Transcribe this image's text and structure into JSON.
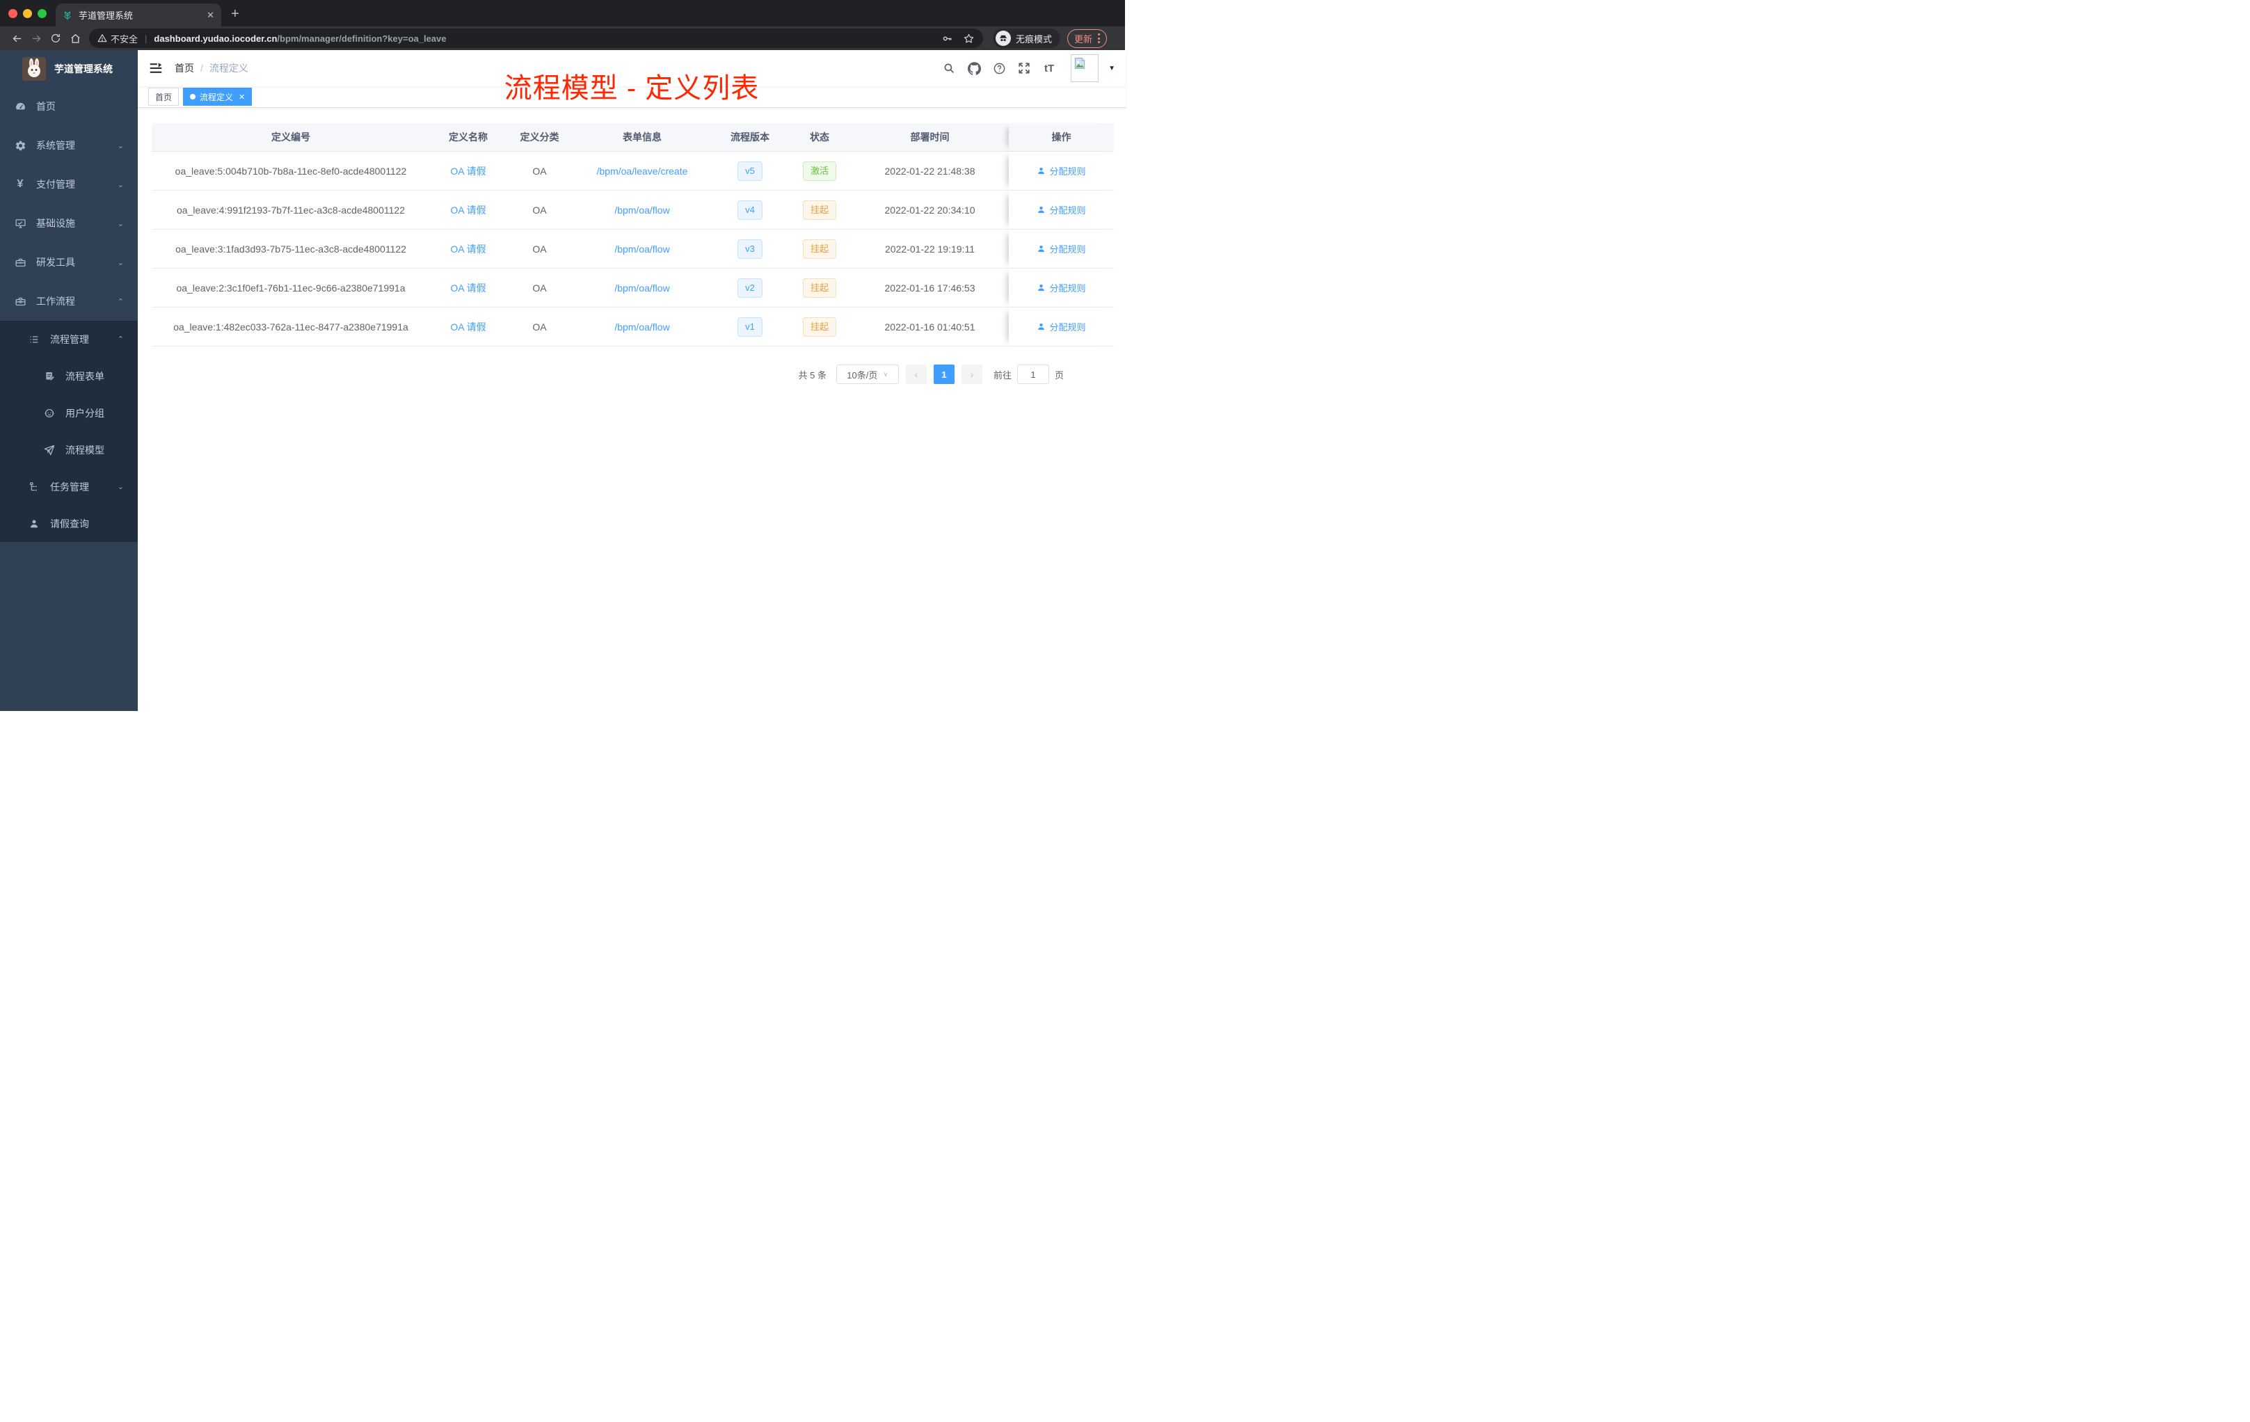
{
  "colors": {
    "accent": "#409EFF",
    "status_active": "#67C23A",
    "status_suspended": "#E6A23C",
    "overlay_red": "#FF2600",
    "sidebar_bg": "#304156",
    "submenu_bg": "#1F2D3D"
  },
  "browser": {
    "tab_title": "芋道管理系统",
    "close_glyph": "✕",
    "newtab_glyph": "+",
    "not_secure_label": "不安全",
    "url_host": "dashboard.yudao.iocoder.cn",
    "url_path": "/bpm/manager/definition?key=oa_leave",
    "incognito_label": "无痕模式",
    "update_label": "更新"
  },
  "sidebar": {
    "title": "芋道管理系统",
    "items": [
      {
        "label": "首页"
      },
      {
        "label": "系统管理"
      },
      {
        "label": "支付管理"
      },
      {
        "label": "基础设施"
      },
      {
        "label": "研发工具"
      },
      {
        "label": "工作流程"
      }
    ],
    "submenu": {
      "groups": [
        {
          "label": "流程管理",
          "children": [
            {
              "label": "流程表单"
            },
            {
              "label": "用户分组"
            },
            {
              "label": "流程模型"
            }
          ]
        },
        {
          "label": "任务管理"
        },
        {
          "label": "请假查询"
        }
      ]
    }
  },
  "navbar": {
    "breadcrumb": {
      "home": "首页",
      "separator": "/",
      "current": "流程定义"
    },
    "overlay_title": "流程模型 - 定义列表",
    "font_icon_label": "tT"
  },
  "tags": [
    {
      "label": "首页",
      "active": false
    },
    {
      "label": "流程定义",
      "active": true,
      "close_glyph": "✕"
    }
  ],
  "table": {
    "columns": [
      "定义编号",
      "定义名称",
      "定义分类",
      "表单信息",
      "流程版本",
      "状态",
      "部署时间",
      "操作"
    ],
    "rows": [
      {
        "id": "oa_leave:5:004b710b-7b8a-11ec-8ef0-acde48001122",
        "name": "OA 请假",
        "category": "OA",
        "form": "/bpm/oa/leave/create",
        "version": "v5",
        "status": "激活",
        "deployed": "2022-01-22 21:48:38",
        "action": "分配规则"
      },
      {
        "id": "oa_leave:4:991f2193-7b7f-11ec-a3c8-acde48001122",
        "name": "OA 请假",
        "category": "OA",
        "form": "/bpm/oa/flow",
        "version": "v4",
        "status": "挂起",
        "deployed": "2022-01-22 20:34:10",
        "action": "分配规则"
      },
      {
        "id": "oa_leave:3:1fad3d93-7b75-11ec-a3c8-acde48001122",
        "name": "OA 请假",
        "category": "OA",
        "form": "/bpm/oa/flow",
        "version": "v3",
        "status": "挂起",
        "deployed": "2022-01-22 19:19:11",
        "action": "分配规则"
      },
      {
        "id": "oa_leave:2:3c1f0ef1-76b1-11ec-9c66-a2380e71991a",
        "name": "OA 请假",
        "category": "OA",
        "form": "/bpm/oa/flow",
        "version": "v2",
        "status": "挂起",
        "deployed": "2022-01-16 17:46:53",
        "action": "分配规则"
      },
      {
        "id": "oa_leave:1:482ec033-762a-11ec-8477-a2380e71991a",
        "name": "OA 请假",
        "category": "OA",
        "form": "/bpm/oa/flow",
        "version": "v1",
        "status": "挂起",
        "deployed": "2022-01-16 01:40:51",
        "action": "分配规则"
      }
    ]
  },
  "pagination": {
    "total": "共 5 条",
    "page_size": "10条/页",
    "prev_glyph": "‹",
    "next_glyph": "›",
    "current_page": "1",
    "goto_label": "前往",
    "input_value": "1",
    "page_unit": "页"
  }
}
